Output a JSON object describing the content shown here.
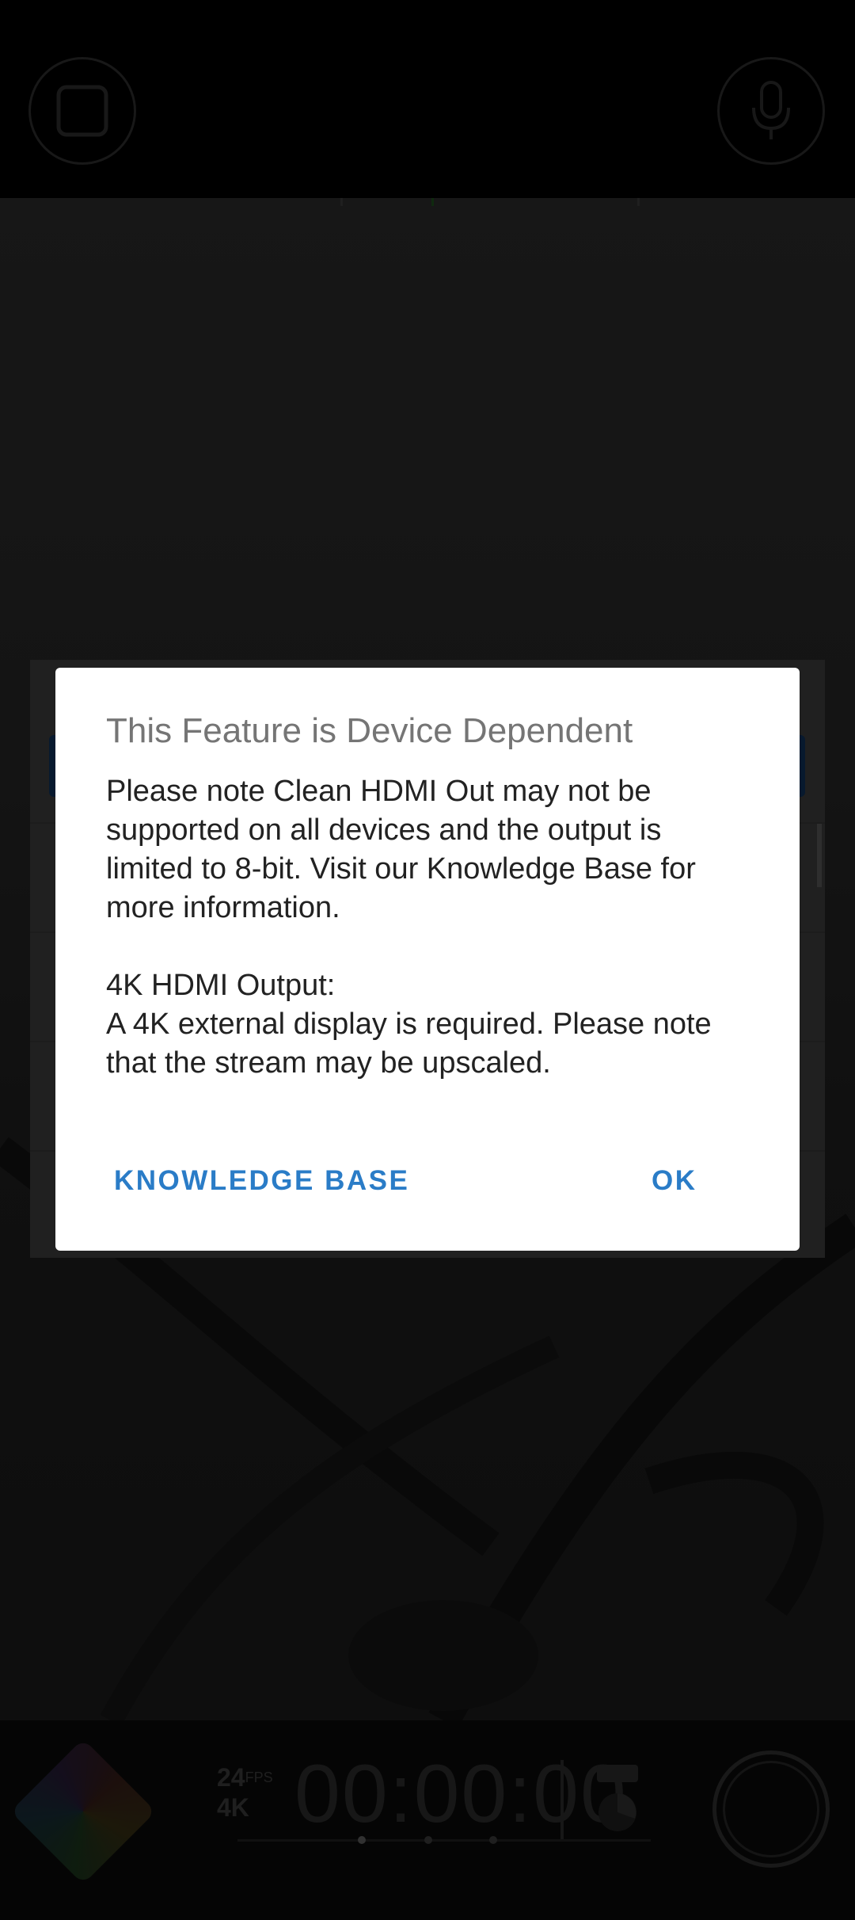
{
  "dialog": {
    "title": "This Feature is Device Dependent",
    "body": "Please note Clean HDMI Out may not be supported on all devices and the output is limited to 8-bit. Visit our Knowledge Base for more information.\n\n4K HDMI Output:\nA 4K external display is required. Please note that the stream may be upscaled.",
    "buttons": {
      "knowledge_base": "KNOWLEDGE BASE",
      "ok": "OK"
    },
    "accent_color": "#2a7cc7"
  },
  "camera": {
    "fps": "24",
    "fps_unit": "FPS",
    "resolution": "4K",
    "timecode": "00:00:00"
  },
  "icons": {
    "top_left": "frame-guide-icon",
    "top_right": "microphone-icon",
    "bottom_left": "lut-diamond-icon",
    "storage": "storage-icon",
    "record": "record-button"
  }
}
